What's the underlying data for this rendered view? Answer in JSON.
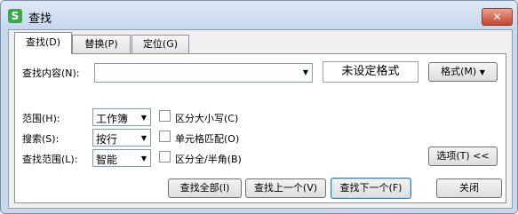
{
  "window": {
    "title": "查找",
    "app_icon": "S",
    "close_label": "✕"
  },
  "tabs": [
    {
      "label": "查找(D)"
    },
    {
      "label": "替换(P)"
    },
    {
      "label": "定位(G)"
    }
  ],
  "find": {
    "label": "查找内容(N):",
    "value": "",
    "format_display": "未设定格式",
    "format_button": "格式(M)"
  },
  "options": {
    "scope": {
      "label": "范围(H):",
      "value": "工作簿"
    },
    "search": {
      "label": "搜索(S):",
      "value": "按行"
    },
    "look_in": {
      "label": "查找范围(L):",
      "value": "智能"
    },
    "match_case": {
      "label": "区分大小写(C)",
      "checked": false
    },
    "match_cell": {
      "label": "单元格匹配(O)",
      "checked": false
    },
    "match_width": {
      "label": "区分全/半角(B)",
      "checked": false
    },
    "options_button": "选项(T) <<"
  },
  "buttons": {
    "find_all": "查找全部(I)",
    "find_prev": "查找上一个(V)",
    "find_next": "查找下一个(F)",
    "close": "关闭"
  },
  "icons": {
    "dropdown": "▼"
  }
}
